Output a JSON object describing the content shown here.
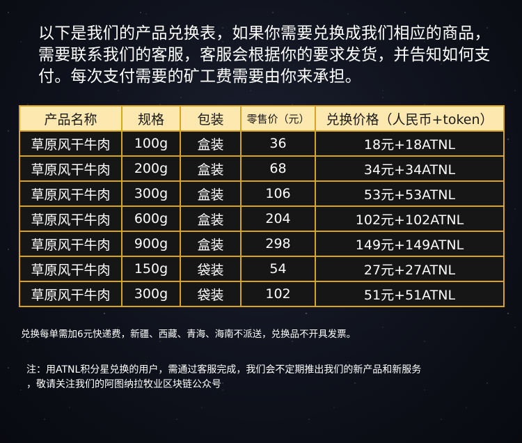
{
  "intro": "以下是我们的产品兑换表，如果你需要兑换成我们相应的商品，需要联系我们的客服，客服会根据你的要求发货，并告知如何支付。每次支付需要的矿工费需要由你来承担。",
  "table": {
    "headers": [
      "产品名称",
      "规格",
      "包装",
      "零售价（元）",
      "兑换价格（人民币+token）"
    ],
    "rows": [
      [
        "草原风干牛肉",
        "100g",
        "盒装",
        "36",
        "18元+18ATNL"
      ],
      [
        "草原风干牛肉",
        "200g",
        "盒装",
        "68",
        "34元+34ATNL"
      ],
      [
        "草原风干牛肉",
        "300g",
        "盒装",
        "106",
        "53元+53ATNL"
      ],
      [
        "草原风干牛肉",
        "600g",
        "盒装",
        "204",
        "102元+102ATNL"
      ],
      [
        "草原风干牛肉",
        "900g",
        "盒装",
        "298",
        "149元+149ATNL"
      ],
      [
        "草原风干牛肉",
        "150g",
        "袋装",
        "54",
        "27元+27ATNL"
      ],
      [
        "草原风干牛肉",
        "300g",
        "袋装",
        "102",
        "51元+51ATNL"
      ]
    ]
  },
  "shipping_note": "兑换每单需加6元快递费，新疆、西藏、青海、海南不派送，兑换品不开具发票。",
  "footnote": {
    "line1": "注：用ATNL积分星兑换的用户，需通过客服完成，我们会不定期推出我们的新产品和新服务",
    "line2": "，敬请关注我们的阿图纳拉牧业区块链公众号"
  },
  "colors": {
    "border": "#d9a520",
    "header_bg": "#fde8b0",
    "cell_bg": "#161616"
  }
}
